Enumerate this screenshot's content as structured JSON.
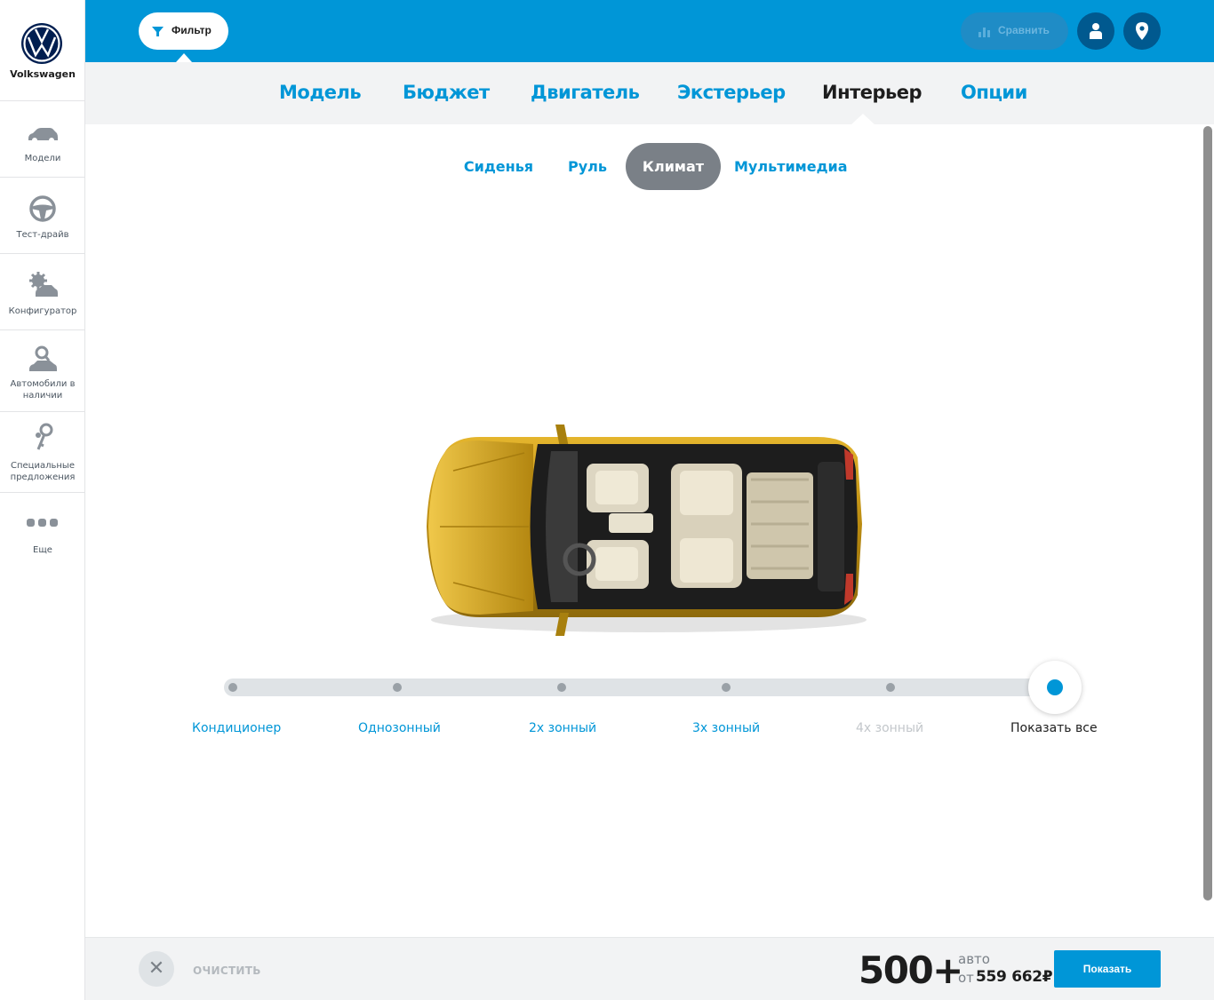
{
  "brand": {
    "name": "Volkswagen",
    "logo": "vw-logo"
  },
  "sidebar": {
    "items": [
      {
        "label": "Модели",
        "icon": "car-icon"
      },
      {
        "label": "Тест-драйв",
        "icon": "steering-wheel-icon"
      },
      {
        "label": "Конфигуратор",
        "icon": "configurator-gear-car-icon"
      },
      {
        "label": "Автомобили в наличии",
        "icon": "car-search-icon"
      },
      {
        "label": "Специальные предложения",
        "icon": "keys-icon"
      },
      {
        "label": "Еще",
        "icon": "more-dots-icon"
      }
    ]
  },
  "topbar": {
    "filter_label": "Фильтр",
    "compare_label": "Сравнить",
    "icons": [
      "filter-icon",
      "bar-chart-icon",
      "user-icon",
      "location-pin-icon"
    ]
  },
  "categories": [
    {
      "label": "Модель",
      "active": false
    },
    {
      "label": "Бюджет",
      "active": false
    },
    {
      "label": "Двигатель",
      "active": false
    },
    {
      "label": "Экстерьер",
      "active": false
    },
    {
      "label": "Интерьер",
      "active": true
    },
    {
      "label": "Опции",
      "active": false
    }
  ],
  "subtabs": [
    {
      "label": "Сиденья",
      "active": false
    },
    {
      "label": "Руль",
      "active": false
    },
    {
      "label": "Климат",
      "active": true
    },
    {
      "label": "Мультимедиа",
      "active": false
    }
  ],
  "climate_slider": {
    "selected": "Показать все",
    "stops": [
      {
        "label": "Кондиционер",
        "state": "available"
      },
      {
        "label": "Однозонный",
        "state": "available"
      },
      {
        "label": "2х зонный",
        "state": "available"
      },
      {
        "label": "3х зонный",
        "state": "available"
      },
      {
        "label": "4х зонный",
        "state": "disabled"
      },
      {
        "label": "Показать все",
        "state": "selected"
      }
    ]
  },
  "bottombar": {
    "clear_label": "ОЧИСТИТЬ",
    "count": "500+",
    "count_unit": "авто",
    "price_prefix": "от",
    "price": "559 662₽",
    "show_label": "Показать"
  },
  "colors": {
    "accent": "#0096d7",
    "dark_accent": "#00598f",
    "car_body": "#c99a14",
    "active_tab": "#7a8087"
  }
}
